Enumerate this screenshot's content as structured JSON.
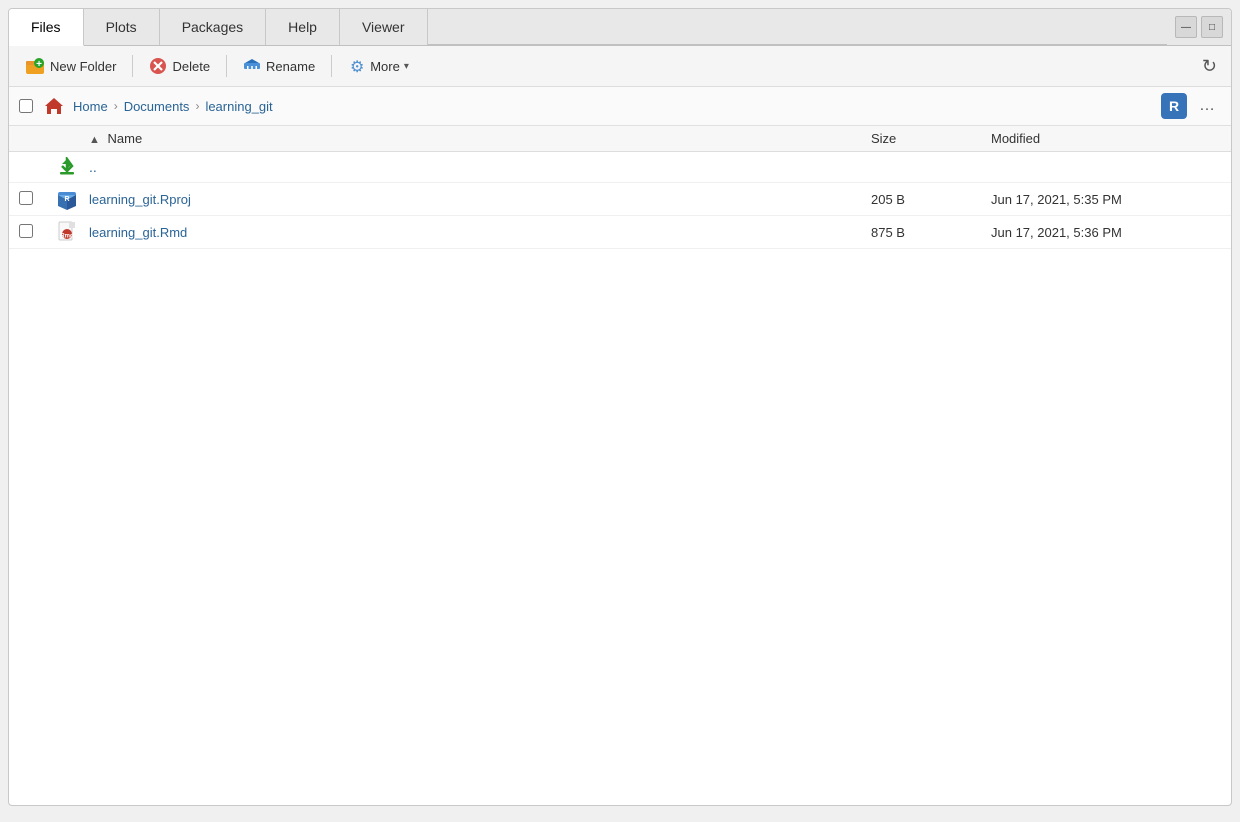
{
  "tabs": [
    {
      "id": "files",
      "label": "Files",
      "active": true
    },
    {
      "id": "plots",
      "label": "Plots",
      "active": false
    },
    {
      "id": "packages",
      "label": "Packages",
      "active": false
    },
    {
      "id": "help",
      "label": "Help",
      "active": false
    },
    {
      "id": "viewer",
      "label": "Viewer",
      "active": false
    }
  ],
  "toolbar": {
    "new_folder_label": "New Folder",
    "delete_label": "Delete",
    "rename_label": "Rename",
    "more_label": "More",
    "more_caret": "▾"
  },
  "breadcrumb": {
    "home_label": "Home",
    "documents_label": "Documents",
    "current_label": "learning_git",
    "arrow": "❯"
  },
  "columns": {
    "name_label": "Name",
    "name_sort": "▲",
    "size_label": "Size",
    "modified_label": "Modified"
  },
  "files": [
    {
      "id": "parent",
      "type": "parent",
      "name": "..",
      "size": "",
      "modified": ""
    },
    {
      "id": "rproj",
      "type": "rproj",
      "name": "learning_git.Rproj",
      "size": "205 B",
      "modified": "Jun 17, 2021, 5:35 PM"
    },
    {
      "id": "rmd",
      "type": "rmd",
      "name": "learning_git.Rmd",
      "size": "875 B",
      "modified": "Jun 17, 2021, 5:36 PM"
    }
  ],
  "window_buttons": {
    "minimize": "—",
    "maximize": "□"
  },
  "refresh_icon": "↻",
  "more_menu_icon": "⚙",
  "r_badge_icon": "R",
  "ellipsis": "…"
}
